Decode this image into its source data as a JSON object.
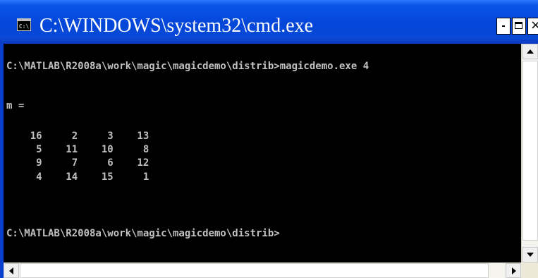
{
  "window": {
    "title": "C:\\WINDOWS\\system32\\cmd.exe",
    "icon_name": "console-icon",
    "icon_glyph": "C:\\"
  },
  "console": {
    "lines": [
      "C:\\MATLAB\\R2008a\\work\\magic\\magicdemo\\distrib>magicdemo.exe 4",
      "",
      "m =",
      "",
      "    16     2     3    13",
      "     5    11    10     8",
      "     9     7     6    12",
      "     4    14    15     1",
      "",
      "",
      "C:\\MATLAB\\R2008a\\work\\magic\\magicdemo\\distrib>"
    ]
  },
  "colors": {
    "titlebar": "#0346d8",
    "console_bg": "#000000",
    "console_fg": "#c0c0c0"
  }
}
